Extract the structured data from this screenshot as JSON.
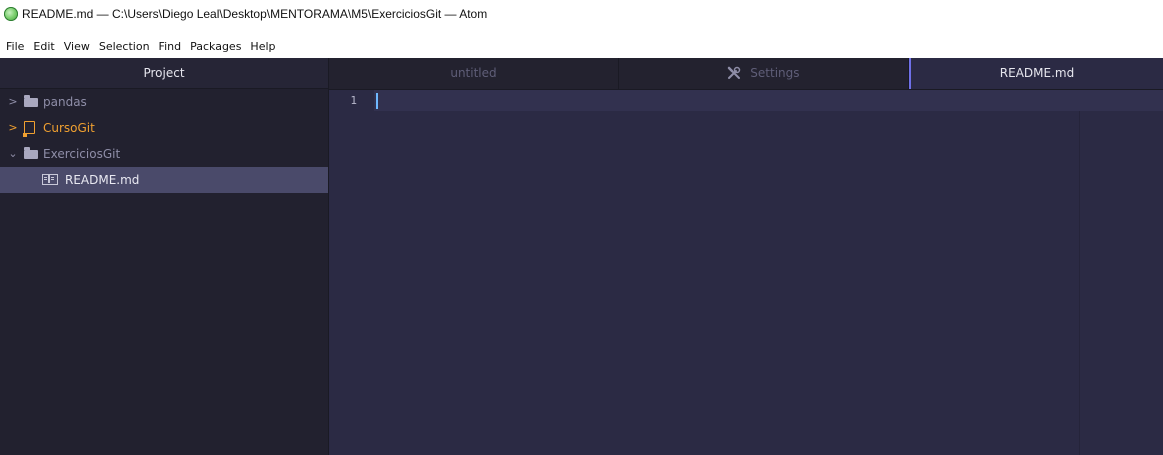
{
  "window": {
    "title": "README.md — C:\\Users\\Diego Leal\\Desktop\\MENTORAMA\\M5\\ExerciciosGit — Atom",
    "logo_icon": "atom-logo-icon"
  },
  "menu": {
    "items": [
      "File",
      "Edit",
      "View",
      "Selection",
      "Find",
      "Packages",
      "Help"
    ]
  },
  "tree_view": {
    "header": "Project",
    "items": [
      {
        "label": "pandas",
        "icon": "folder-icon",
        "expanded": false
      },
      {
        "label": "CursoGit",
        "icon": "repo-icon",
        "expanded": false
      },
      {
        "label": "ExerciciosGit",
        "icon": "folder-icon",
        "expanded": true
      },
      {
        "label": "README.md",
        "icon": "book-icon",
        "selected": true
      }
    ]
  },
  "tabs": [
    {
      "label": "untitled",
      "active": false
    },
    {
      "label": "Settings",
      "icon": "tools-icon",
      "active": false
    },
    {
      "label": "README.md",
      "active": true
    }
  ],
  "editor": {
    "line_numbers": [
      "1"
    ]
  },
  "colors": {
    "background": "#2b2a44",
    "tree_background": "#22212f",
    "accent": "#6f70e8",
    "git_folder": "#f0a030"
  }
}
